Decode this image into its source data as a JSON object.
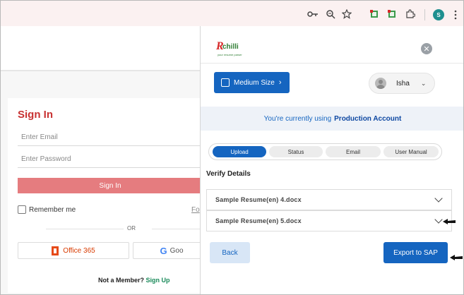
{
  "browser": {
    "toolbar_icons": [
      "key-icon",
      "zoom-icon",
      "star-icon",
      "extension-green-icon",
      "extension-red-icon",
      "puzzle-icon"
    ],
    "profile_initial": "S"
  },
  "signin": {
    "title": "Sign In",
    "email_placeholder": "Enter Email",
    "password_placeholder": "Enter Password",
    "signin_label": "Sign In",
    "remember_label": "Remember me",
    "forgot_label": "Fo",
    "or_label": "OR",
    "office_label": "Office 365",
    "google_label": "Goo",
    "member_text": "Not a Member?",
    "signup_label": "Sign Up"
  },
  "panel": {
    "logo": {
      "text": "chilli",
      "mark": "R",
      "tagline": "your resume parser"
    },
    "size_button": "Medium Size",
    "user_name": "Isha",
    "account_text": "You're currently using",
    "account_name": "Production Account",
    "tabs": [
      {
        "label": "Upload",
        "active": true
      },
      {
        "label": "Status",
        "active": false
      },
      {
        "label": "Email",
        "active": false
      },
      {
        "label": "User Manual",
        "active": false
      }
    ],
    "verify_title": "Verify Details",
    "files": [
      "Sample Resume(en) 4.docx",
      "Sample Resume(en) 5.docx"
    ],
    "back_label": "Back",
    "export_label": "Export to SAP"
  },
  "colors": {
    "primary": "#1565c0",
    "signin_red": "#c83232",
    "signin_button": "#e57c7f",
    "toolbar_bg": "#fbf1f1"
  }
}
